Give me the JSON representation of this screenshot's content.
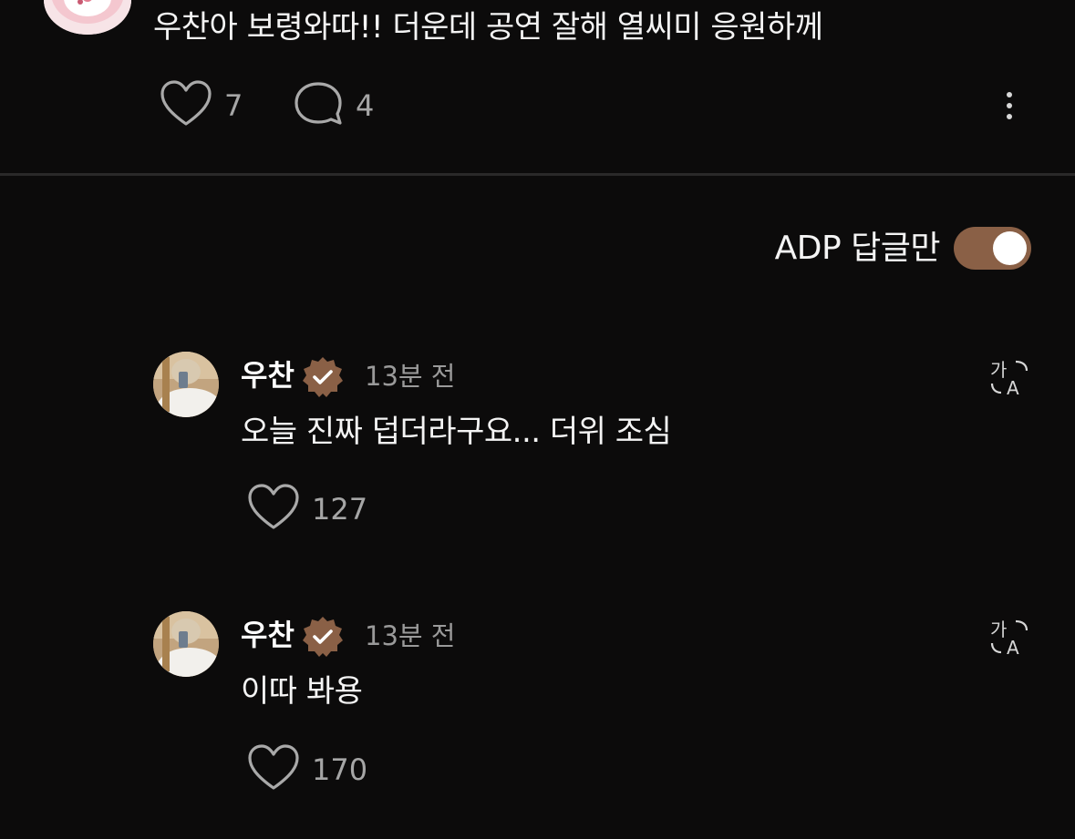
{
  "post": {
    "text": "우찬아 보령와따!! 더운데 공연 잘해 열씨미 응원하께",
    "like_count": "7",
    "comment_count": "4"
  },
  "filter": {
    "label": "ADP 답글만",
    "enabled": true
  },
  "replies": [
    {
      "author": "우찬",
      "time": "13분 전",
      "text": "오늘 진짜 덥더라구요... 더위 조심",
      "like_count": "127"
    },
    {
      "author": "우찬",
      "time": "13분 전",
      "text": "이따 봐용",
      "like_count": "170"
    }
  ],
  "colors": {
    "background": "#0c0b0b",
    "accent_brown": "#8a6046",
    "muted_text": "#9a9a9a"
  },
  "icons": {
    "like": "heart-outline-icon",
    "comment": "speech-bubble-icon",
    "more": "vertical-dots-icon",
    "verified": "verified-badge-icon",
    "translate": "translate-icon"
  }
}
